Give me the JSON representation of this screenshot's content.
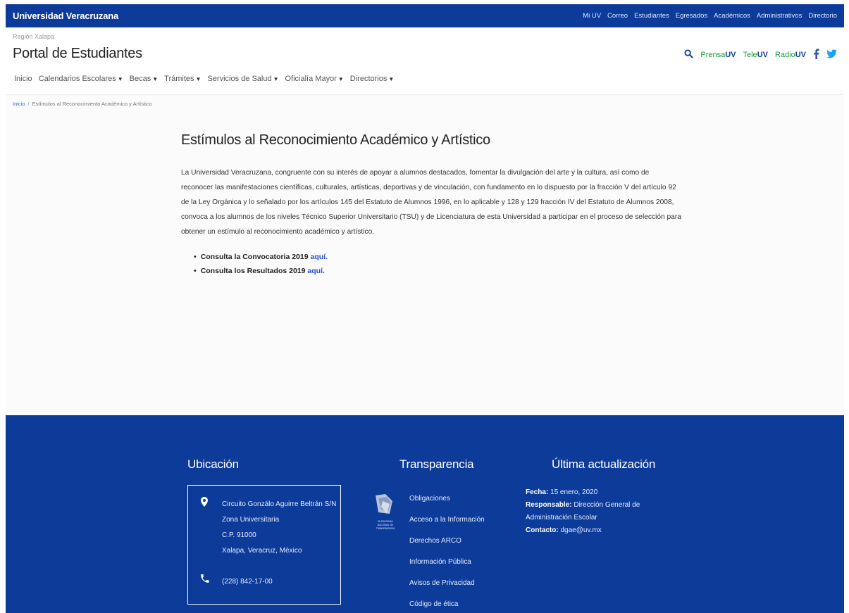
{
  "topbar": {
    "brand": "Universidad Veracruzana",
    "links": [
      "Mi UV",
      "Correo",
      "Estudiantes",
      "Egresados",
      "Académicos",
      "Administrativos",
      "Directorio"
    ]
  },
  "header": {
    "region": "Región Xalapa",
    "title": "Portal de Estudiantes",
    "social": {
      "prensa_a": "Prensa",
      "prensa_b": "UV",
      "tele_a": "Tele",
      "tele_b": "UV",
      "radio_a": "Radio",
      "radio_b": "UV"
    },
    "nav": [
      {
        "label": "Inicio",
        "dropdown": false
      },
      {
        "label": "Calendarios Escolares",
        "dropdown": true
      },
      {
        "label": "Becas",
        "dropdown": true
      },
      {
        "label": "Trámites",
        "dropdown": true
      },
      {
        "label": "Servicios de Salud",
        "dropdown": true
      },
      {
        "label": "Oficialía Mayor",
        "dropdown": true
      },
      {
        "label": "Directorios",
        "dropdown": true
      }
    ]
  },
  "breadcrumb": {
    "home": "Inicio",
    "separator": "/",
    "current": "Estímulos al Reconocimiento Académico y Artístico"
  },
  "main": {
    "title": "Estímulos al Reconocimiento Académico y Artístico",
    "paragraph": "La Universidad Veracruzana, congruente con su interés de apoyar a alumnos destacados, fomentar la divulgación del arte y la cultura, así como de reconocer las manifestaciones científicas, culturales, artísticas, deportivas y de vinculación, con fundamento en lo dispuesto por la fracción V del artículo 92 de la Ley Orgánica y lo señalado por los artículos 145 del Estatuto de Alumnos 1996, en lo aplicable y 128 y 129 fracción IV del Estatuto de Alumnos 2008, convoca a los alumnos de los niveles Técnico Superior Universitario (TSU) y de Licenciatura de esta Universidad a participar en el proceso de selección para obtener un estímulo al reconocimiento académico y artístico.",
    "items": [
      {
        "text": "Consulta la Convocatoria 2019 ",
        "link": "aquí."
      },
      {
        "text": "Consulta los Resultados 2019 ",
        "link": "aquí."
      }
    ]
  },
  "footer": {
    "location": {
      "title": "Ubicación",
      "address": [
        "Circuito Gonzálo Aguirre Beltrán S/N",
        "Zona Universitaria",
        "C.P. 91000",
        "Xalapa, Veracruz, México"
      ],
      "phone": "(228) 842-17-00"
    },
    "transparency": {
      "title": "Transparencia",
      "logo_text": [
        "PLATAFORMA",
        "NACIONAL DE",
        "TRANSPARENCIA"
      ],
      "links": [
        "Obligaciones",
        "Acceso a la Información",
        "Derechos ARCO",
        "Información Pública",
        "Avisos de Privacidad",
        "Código de ética"
      ]
    },
    "update": {
      "title": "Última actualización",
      "fecha_label": "Fecha:",
      "fecha": " 15 enero, 2020",
      "responsable_label": "Responsable:",
      "responsable": " Dirección General de Administración Escolar",
      "contacto_label": "Contacto:",
      "contacto": " dgae@uv.mx"
    }
  },
  "colors": {
    "brand_blue": "#0c3b9a",
    "link_blue": "#2350d8",
    "uv_green": "#1a9a3c",
    "facebook_blue": "#3b5998",
    "twitter_blue": "#1da1f2"
  },
  "icons": [
    "search-icon",
    "facebook-icon",
    "twitter-icon",
    "map-marker-icon",
    "phone-icon",
    "caret-down-icon"
  ]
}
